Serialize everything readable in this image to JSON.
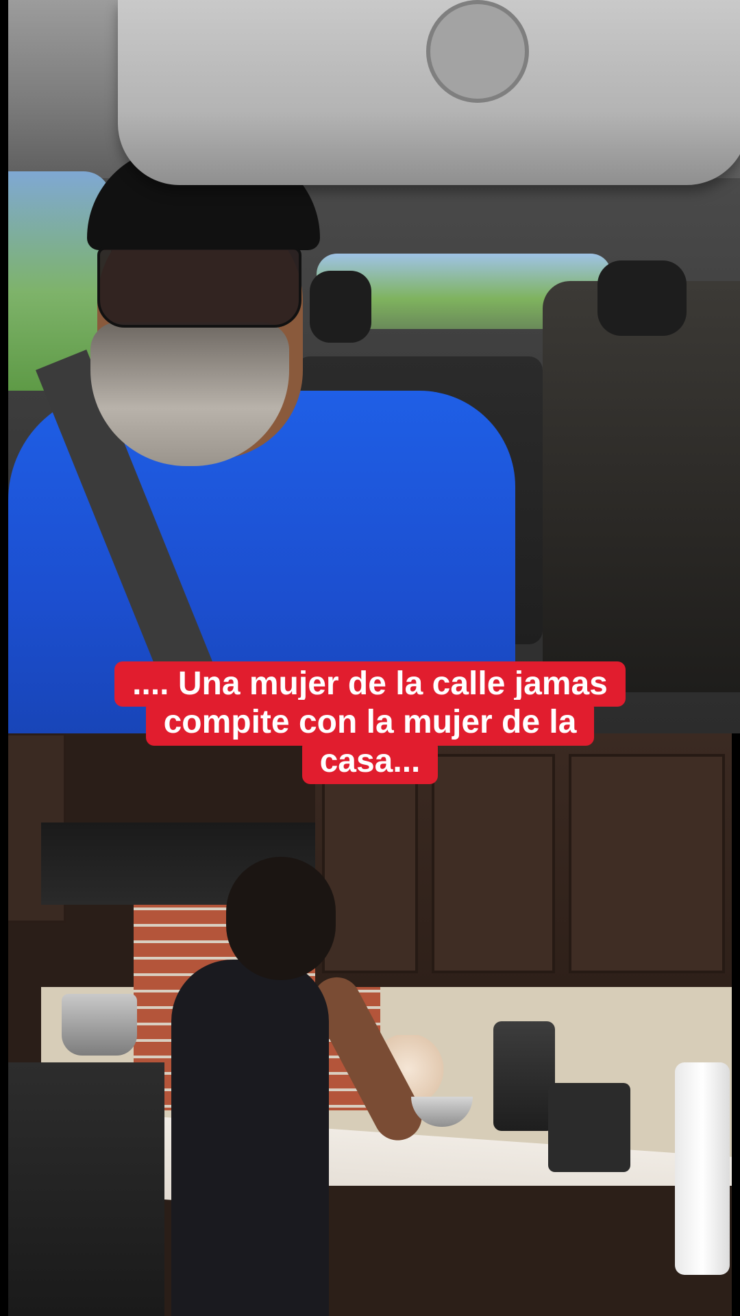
{
  "video": {
    "top_clip": "car interior selfie video",
    "bottom_clip": "kitchen scene video"
  },
  "caption": {
    "lines": [
      ".... Una mujer de la calle jamas",
      "compite con la mujer de la",
      "casa..."
    ],
    "background_color": "#e11d2e",
    "text_color": "#ffffff"
  }
}
